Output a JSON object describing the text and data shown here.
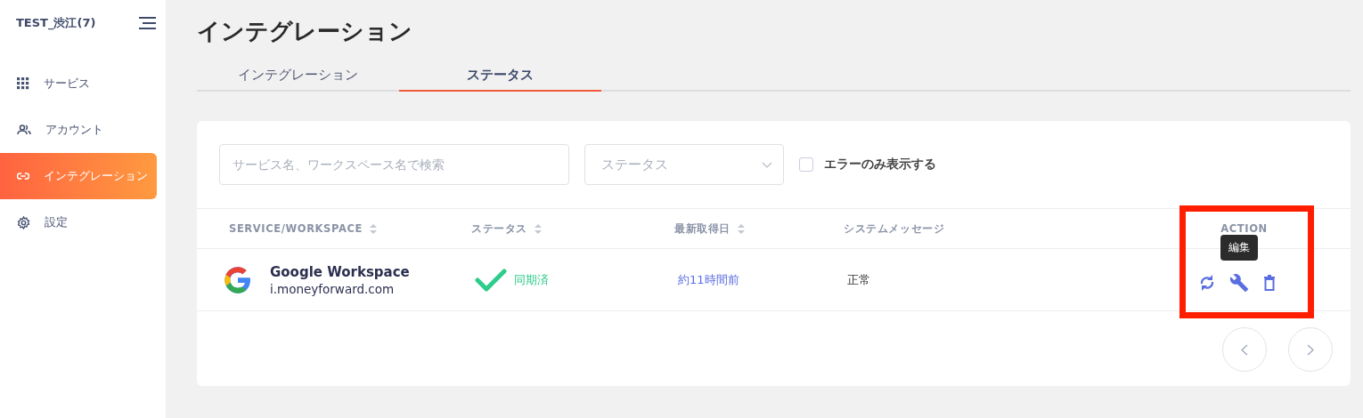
{
  "sidebar": {
    "org": "TEST_渋江(7)",
    "items": [
      {
        "label": "サービス",
        "selected": false
      },
      {
        "label": "アカウント",
        "selected": false
      },
      {
        "label": "インテグレーション",
        "selected": true
      },
      {
        "label": "設定",
        "selected": false
      }
    ]
  },
  "page_title": "インテグレーション",
  "tabs": [
    {
      "label": "インテグレーション",
      "selected": false
    },
    {
      "label": "ステータス",
      "selected": true
    }
  ],
  "filters": {
    "search": {
      "placeholder": "サービス名、ワークスペース名で検索"
    },
    "status_select": {
      "placeholder": "ステータス"
    },
    "errors_only": {
      "label": "エラーのみ表示する",
      "checked": false
    }
  },
  "table": {
    "columns": [
      {
        "label": "SERVICE/WORKSPACE",
        "sortable": true
      },
      {
        "label": "ステータス",
        "sortable": true
      },
      {
        "label": "最新取得日",
        "sortable": true
      },
      {
        "label": "システムメッセージ",
        "sortable": false
      },
      {
        "label": "ACTION",
        "sortable": false
      }
    ],
    "rows": [
      {
        "service": "Google Workspace",
        "workspace": "i.moneyforward.com",
        "status": "同期済",
        "last_fetched": "約11時間前",
        "message": "正常"
      }
    ]
  },
  "tooltip": "編集"
}
